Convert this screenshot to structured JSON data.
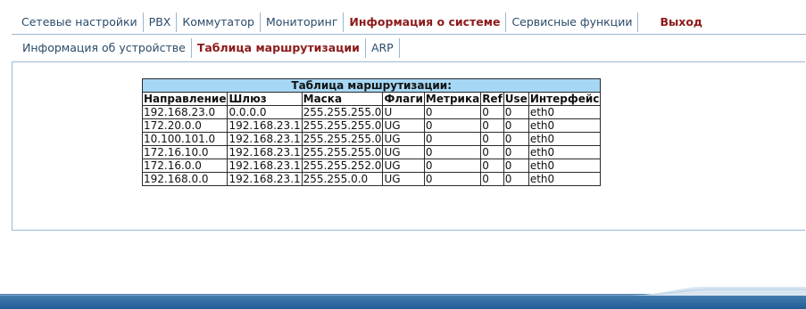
{
  "top_tabs": [
    {
      "label": "Сетевые настройки",
      "active": false
    },
    {
      "label": "PBX",
      "active": false
    },
    {
      "label": "Коммутатор",
      "active": false
    },
    {
      "label": "Мониторинг",
      "active": false
    },
    {
      "label": "Информация о системе",
      "active": true
    },
    {
      "label": "Сервисные функции",
      "active": false
    }
  ],
  "exit_label": "Выход",
  "sub_tabs": [
    {
      "label": "Информация об устройстве",
      "active": false
    },
    {
      "label": "Таблица маршрутизации",
      "active": true
    },
    {
      "label": "ARP",
      "active": false
    }
  ],
  "routing_table": {
    "caption": "Таблица маршрутизации:",
    "headers": [
      "Направление",
      "Шлюз",
      "Маска",
      "Флаги",
      "Метрика",
      "Ref",
      "Use",
      "Интерфейс"
    ],
    "rows": [
      [
        "192.168.23.0",
        "0.0.0.0",
        "255.255.255.0",
        "U",
        "0",
        "0",
        "0",
        "eth0"
      ],
      [
        "172.20.0.0",
        "192.168.23.1",
        "255.255.255.0",
        "UG",
        "0",
        "0",
        "0",
        "eth0"
      ],
      [
        "10.100.101.0",
        "192.168.23.1",
        "255.255.255.0",
        "UG",
        "0",
        "0",
        "0",
        "eth0"
      ],
      [
        "172.16.10.0",
        "192.168.23.1",
        "255.255.255.0",
        "UG",
        "0",
        "0",
        "0",
        "eth0"
      ],
      [
        "172.16.0.0",
        "192.168.23.1",
        "255.255.252.0",
        "UG",
        "0",
        "0",
        "0",
        "eth0"
      ],
      [
        "192.168.0.0",
        "192.168.23.1",
        "255.255.0.0",
        "UG",
        "0",
        "0",
        "0",
        "eth0"
      ]
    ]
  },
  "colors": {
    "tab_text": "#2a4a6a",
    "active_tab_text": "#8c1a1a",
    "table_caption_bg": "#a6d8f5",
    "footer_bar": "#1f5d96"
  }
}
